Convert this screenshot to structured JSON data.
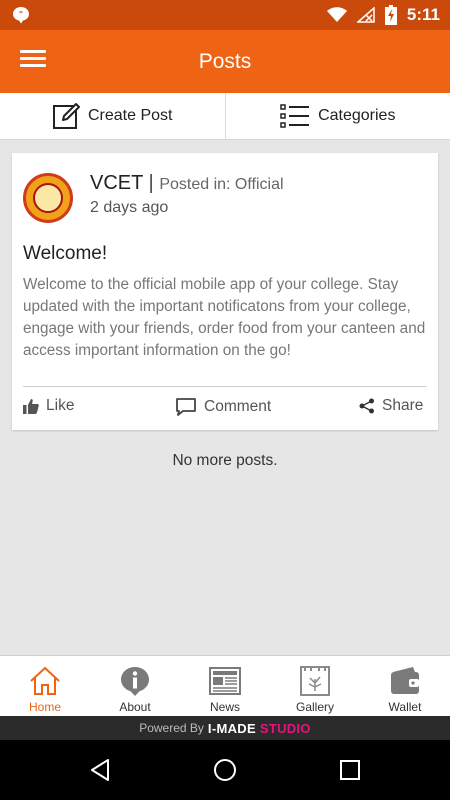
{
  "status_bar": {
    "time": "5:11",
    "icons": [
      "chat-bubble-icon",
      "wifi-icon",
      "no-signal-icon",
      "battery-charging-icon"
    ]
  },
  "app_bar": {
    "title": "Posts",
    "menu_icon": "hamburger-menu-icon"
  },
  "actions": {
    "create_post": "Create Post",
    "categories": "Categories"
  },
  "post": {
    "author": "VCET",
    "separator": "|",
    "posted_in": "Posted in: Official",
    "time_ago": "2 days ago",
    "title": "Welcome!",
    "body": "Welcome to the official mobile app of your college. Stay updated with the important notificatons from your college, engage with your friends, order food from your canteen and access important information on the go!",
    "actions": {
      "like": "Like",
      "comment": "Comment",
      "share": "Share"
    }
  },
  "feed_end_text": "No more posts.",
  "bottom_nav": {
    "items": [
      {
        "label": "Home",
        "icon": "home-icon",
        "active": true
      },
      {
        "label": "About",
        "icon": "info-icon",
        "active": false
      },
      {
        "label": "News",
        "icon": "newspaper-icon",
        "active": false
      },
      {
        "label": "Gallery",
        "icon": "gallery-icon",
        "active": false
      },
      {
        "label": "Wallet",
        "icon": "wallet-icon",
        "active": false
      }
    ]
  },
  "footer": {
    "powered_by": "Powered By",
    "brand": "I-MADE",
    "brand_suffix": "STUDIO"
  },
  "colors": {
    "status_bar": "#c94a0a",
    "accent": "#ef6414",
    "brand_pink": "#e6137e"
  }
}
